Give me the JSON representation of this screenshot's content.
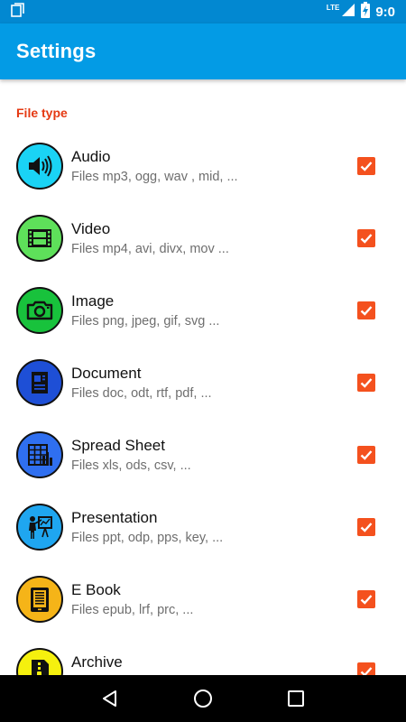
{
  "status_bar": {
    "network": "LTE",
    "time": "9:0"
  },
  "app_bar": {
    "title": "Settings"
  },
  "section": {
    "title": "File type"
  },
  "file_types": [
    {
      "name": "audio",
      "title": "Audio",
      "subtitle": "Files mp3, ogg, wav , mid, ...",
      "icon": "speaker-icon",
      "color": "#1ad3f5",
      "checked": true
    },
    {
      "name": "video",
      "title": "Video",
      "subtitle": "Files mp4, avi, divx, mov ...",
      "icon": "film-icon",
      "color": "#5ee05a",
      "checked": true
    },
    {
      "name": "image",
      "title": "Image",
      "subtitle": "Files png, jpeg, gif, svg ...",
      "icon": "camera-icon",
      "color": "#18c23c",
      "checked": true
    },
    {
      "name": "document",
      "title": "Document",
      "subtitle": "Files doc, odt, rtf, pdf, ...",
      "icon": "document-icon",
      "color": "#1e4fd6",
      "checked": true
    },
    {
      "name": "spreadsheet",
      "title": "Spread Sheet",
      "subtitle": "Files xls, ods, csv, ...",
      "icon": "spreadsheet-icon",
      "color": "#2f6ff0",
      "checked": true
    },
    {
      "name": "presentation",
      "title": "Presentation",
      "subtitle": "Files ppt, odp, pps, key, ...",
      "icon": "presenter-icon",
      "color": "#1fa6f0",
      "checked": true
    },
    {
      "name": "ebook",
      "title": "E Book",
      "subtitle": "Files epub, lrf, prc, ...",
      "icon": "ebook-reader-icon",
      "color": "#f5b418",
      "checked": true
    },
    {
      "name": "archive",
      "title": "Archive",
      "subtitle": "",
      "icon": "archive-icon",
      "color": "#f5f00e",
      "checked": true
    }
  ],
  "colors": {
    "status_bar": "#0288d1",
    "app_bar": "#039be5",
    "accent": "#e53912",
    "checkbox": "#f4511e"
  }
}
